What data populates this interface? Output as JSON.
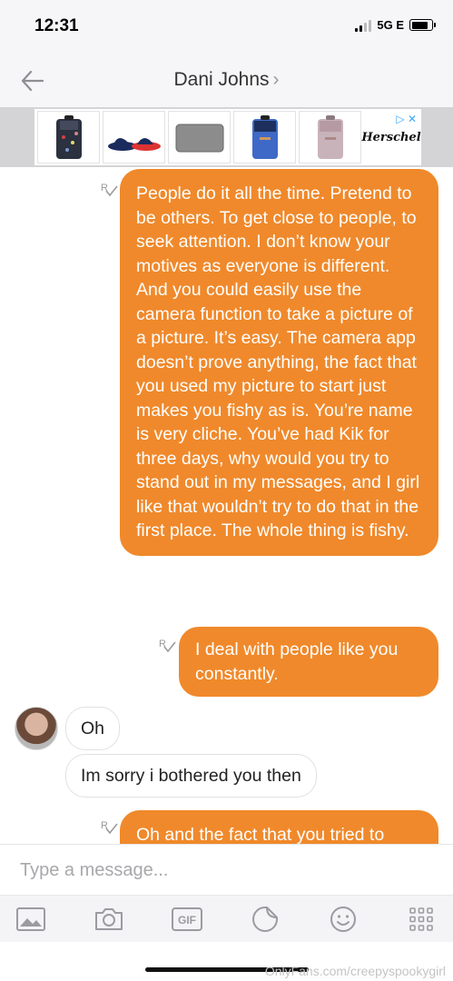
{
  "status_bar": {
    "time": "12:31",
    "network": "5G E"
  },
  "header": {
    "title": "Dani Johns",
    "chevron": "›"
  },
  "ad": {
    "brand": "Herschel",
    "choices_label": "▷ ✕"
  },
  "messages": {
    "out1": "People do it all the time. Pretend to be others. To get close to people, to seek attention. I don’t know your motives as everyone is different. And you could easily use the camera function to take a picture of a picture. It’s easy. The camera app doesn’t prove anything, the fact that you used my picture to start just makes you fishy as is. You’re name is very cliche. You’ve had Kik for three days, why would you try to stand out in my messages, and I girl like that wouldn’t try to do that in the first place. The whole thing is fishy.",
    "out2": "I deal with people like you constantly.",
    "in1": "Oh",
    "in2": "Im sorry i bothered you then",
    "out3": "Oh and the fact that you tried to"
  },
  "read_receipt_label": "R",
  "input": {
    "placeholder": "Type a message..."
  },
  "toolbar": {
    "gif_label": "GIF"
  },
  "icons": [
    "back-arrow-icon",
    "gallery-icon",
    "camera-icon",
    "gif-icon",
    "sticker-icon",
    "smiley-icon",
    "apps-grid-icon"
  ],
  "watermark": "OnlyFans.com/creepyspookygirl",
  "colors": {
    "outgoing_bubble": "#f0892b",
    "header_bg": "#f6f6f8"
  }
}
